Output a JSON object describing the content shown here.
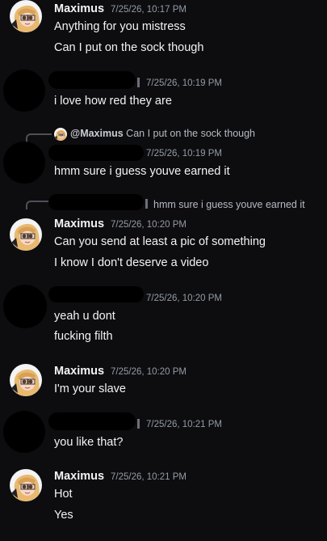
{
  "messages": {
    "m1": {
      "author": "Maximus",
      "time": "7/25/26, 10:17 PM",
      "lines": [
        "Anything for you mistress",
        "Can I put on the sock though"
      ]
    },
    "m2": {
      "time": "7/25/26, 10:19 PM",
      "lines": [
        "i love how red they are"
      ]
    },
    "m3": {
      "reply_author": "@Maximus",
      "reply_text": "Can I put on the sock though",
      "time": "7/25/26, 10:19 PM",
      "lines": [
        "hmm sure i guess youve earned it"
      ]
    },
    "m4": {
      "reply_text": "hmm sure i guess youve earned it",
      "author": "Maximus",
      "time": "7/25/26, 10:20 PM",
      "lines": [
        "Can you send at least a pic of something",
        "I know I don't deserve a video"
      ]
    },
    "m5": {
      "time": "7/25/26, 10:20 PM",
      "lines": [
        "yeah u dont",
        "fucking filth"
      ]
    },
    "m6": {
      "author": "Maximus",
      "time": "7/25/26, 10:20 PM",
      "lines": [
        "I'm your slave"
      ]
    },
    "m7": {
      "time": "7/25/26, 10:21 PM",
      "lines": [
        "you like that?"
      ]
    },
    "m8": {
      "author": "Maximus",
      "time": "7/25/26, 10:21 PM",
      "lines": [
        "Hot",
        "Yes"
      ]
    }
  }
}
